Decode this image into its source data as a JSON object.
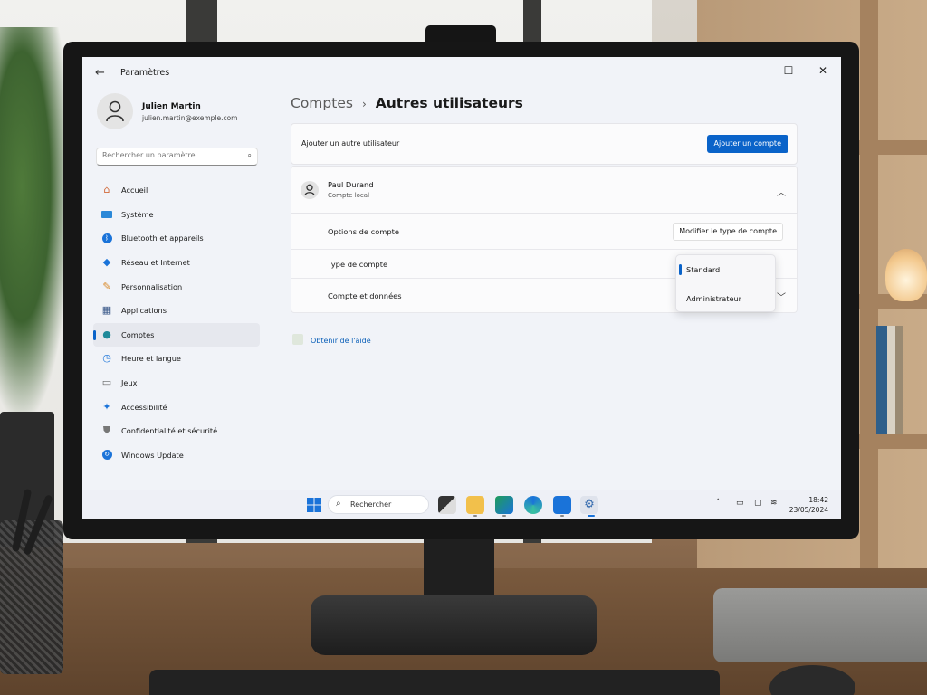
{
  "window": {
    "title": "Paramètres",
    "back_glyph": "←",
    "minimize_glyph": "—",
    "maximize_glyph": "☐",
    "close_glyph": "✕"
  },
  "profile": {
    "name": "Julien Martin",
    "email": "julien.martin@exemple.com"
  },
  "search": {
    "placeholder": "Rechercher un paramètre"
  },
  "sidebar": {
    "items": [
      {
        "label": "Accueil",
        "icon": "home-icon"
      },
      {
        "label": "Système",
        "icon": "system-icon"
      },
      {
        "label": "Bluetooth et appareils",
        "icon": "bluetooth-icon"
      },
      {
        "label": "Réseau et Internet",
        "icon": "network-icon"
      },
      {
        "label": "Personnalisation",
        "icon": "brush-icon"
      },
      {
        "label": "Applications",
        "icon": "apps-icon"
      },
      {
        "label": "Comptes",
        "icon": "account-icon",
        "active": true
      },
      {
        "label": "Heure et langue",
        "icon": "time-language-icon"
      },
      {
        "label": "Jeux",
        "icon": "gamepad-icon"
      },
      {
        "label": "Accessibilité",
        "icon": "accessibility-icon"
      },
      {
        "label": "Confidentialité et sécurité",
        "icon": "shield-icon"
      },
      {
        "label": "Windows Update",
        "icon": "update-icon"
      }
    ]
  },
  "breadcrumb": {
    "parent": "Comptes",
    "separator": "›",
    "current": "Autres utilisateurs"
  },
  "add_user": {
    "label": "Ajouter un autre utilisateur",
    "button": "Ajouter un compte"
  },
  "user": {
    "name": "Paul Durand",
    "type": "Compte local",
    "rows": [
      {
        "label": "Options de compte",
        "button": "Modifier le type de compte"
      },
      {
        "label": "Type de compte"
      },
      {
        "label": "Compte et données"
      }
    ]
  },
  "dropdown": {
    "options": [
      "Standard",
      "Administrateur"
    ],
    "selected": "Standard"
  },
  "help": {
    "label": "Obtenir de l'aide"
  },
  "taskbar": {
    "search_label": "Rechercher",
    "time": "18:42",
    "date": "23/05/2024"
  },
  "colors": {
    "accent": "#0a63c9"
  }
}
